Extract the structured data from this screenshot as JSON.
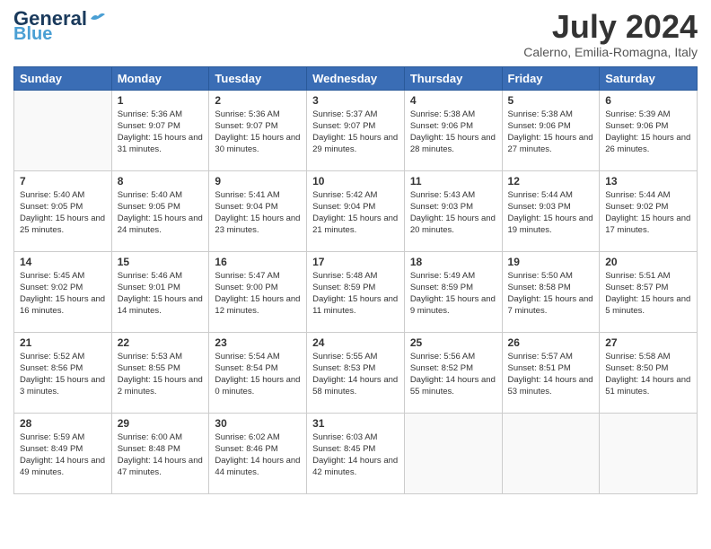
{
  "header": {
    "logo_line1": "General",
    "logo_line2": "Blue",
    "month": "July 2024",
    "location": "Calerno, Emilia-Romagna, Italy"
  },
  "weekdays": [
    "Sunday",
    "Monday",
    "Tuesday",
    "Wednesday",
    "Thursday",
    "Friday",
    "Saturday"
  ],
  "weeks": [
    [
      {
        "day": "",
        "sunrise": "",
        "sunset": "",
        "daylight": ""
      },
      {
        "day": "1",
        "sunrise": "Sunrise: 5:36 AM",
        "sunset": "Sunset: 9:07 PM",
        "daylight": "Daylight: 15 hours and 31 minutes."
      },
      {
        "day": "2",
        "sunrise": "Sunrise: 5:36 AM",
        "sunset": "Sunset: 9:07 PM",
        "daylight": "Daylight: 15 hours and 30 minutes."
      },
      {
        "day": "3",
        "sunrise": "Sunrise: 5:37 AM",
        "sunset": "Sunset: 9:07 PM",
        "daylight": "Daylight: 15 hours and 29 minutes."
      },
      {
        "day": "4",
        "sunrise": "Sunrise: 5:38 AM",
        "sunset": "Sunset: 9:06 PM",
        "daylight": "Daylight: 15 hours and 28 minutes."
      },
      {
        "day": "5",
        "sunrise": "Sunrise: 5:38 AM",
        "sunset": "Sunset: 9:06 PM",
        "daylight": "Daylight: 15 hours and 27 minutes."
      },
      {
        "day": "6",
        "sunrise": "Sunrise: 5:39 AM",
        "sunset": "Sunset: 9:06 PM",
        "daylight": "Daylight: 15 hours and 26 minutes."
      }
    ],
    [
      {
        "day": "7",
        "sunrise": "Sunrise: 5:40 AM",
        "sunset": "Sunset: 9:05 PM",
        "daylight": "Daylight: 15 hours and 25 minutes."
      },
      {
        "day": "8",
        "sunrise": "Sunrise: 5:40 AM",
        "sunset": "Sunset: 9:05 PM",
        "daylight": "Daylight: 15 hours and 24 minutes."
      },
      {
        "day": "9",
        "sunrise": "Sunrise: 5:41 AM",
        "sunset": "Sunset: 9:04 PM",
        "daylight": "Daylight: 15 hours and 23 minutes."
      },
      {
        "day": "10",
        "sunrise": "Sunrise: 5:42 AM",
        "sunset": "Sunset: 9:04 PM",
        "daylight": "Daylight: 15 hours and 21 minutes."
      },
      {
        "day": "11",
        "sunrise": "Sunrise: 5:43 AM",
        "sunset": "Sunset: 9:03 PM",
        "daylight": "Daylight: 15 hours and 20 minutes."
      },
      {
        "day": "12",
        "sunrise": "Sunrise: 5:44 AM",
        "sunset": "Sunset: 9:03 PM",
        "daylight": "Daylight: 15 hours and 19 minutes."
      },
      {
        "day": "13",
        "sunrise": "Sunrise: 5:44 AM",
        "sunset": "Sunset: 9:02 PM",
        "daylight": "Daylight: 15 hours and 17 minutes."
      }
    ],
    [
      {
        "day": "14",
        "sunrise": "Sunrise: 5:45 AM",
        "sunset": "Sunset: 9:02 PM",
        "daylight": "Daylight: 15 hours and 16 minutes."
      },
      {
        "day": "15",
        "sunrise": "Sunrise: 5:46 AM",
        "sunset": "Sunset: 9:01 PM",
        "daylight": "Daylight: 15 hours and 14 minutes."
      },
      {
        "day": "16",
        "sunrise": "Sunrise: 5:47 AM",
        "sunset": "Sunset: 9:00 PM",
        "daylight": "Daylight: 15 hours and 12 minutes."
      },
      {
        "day": "17",
        "sunrise": "Sunrise: 5:48 AM",
        "sunset": "Sunset: 8:59 PM",
        "daylight": "Daylight: 15 hours and 11 minutes."
      },
      {
        "day": "18",
        "sunrise": "Sunrise: 5:49 AM",
        "sunset": "Sunset: 8:59 PM",
        "daylight": "Daylight: 15 hours and 9 minutes."
      },
      {
        "day": "19",
        "sunrise": "Sunrise: 5:50 AM",
        "sunset": "Sunset: 8:58 PM",
        "daylight": "Daylight: 15 hours and 7 minutes."
      },
      {
        "day": "20",
        "sunrise": "Sunrise: 5:51 AM",
        "sunset": "Sunset: 8:57 PM",
        "daylight": "Daylight: 15 hours and 5 minutes."
      }
    ],
    [
      {
        "day": "21",
        "sunrise": "Sunrise: 5:52 AM",
        "sunset": "Sunset: 8:56 PM",
        "daylight": "Daylight: 15 hours and 3 minutes."
      },
      {
        "day": "22",
        "sunrise": "Sunrise: 5:53 AM",
        "sunset": "Sunset: 8:55 PM",
        "daylight": "Daylight: 15 hours and 2 minutes."
      },
      {
        "day": "23",
        "sunrise": "Sunrise: 5:54 AM",
        "sunset": "Sunset: 8:54 PM",
        "daylight": "Daylight: 15 hours and 0 minutes."
      },
      {
        "day": "24",
        "sunrise": "Sunrise: 5:55 AM",
        "sunset": "Sunset: 8:53 PM",
        "daylight": "Daylight: 14 hours and 58 minutes."
      },
      {
        "day": "25",
        "sunrise": "Sunrise: 5:56 AM",
        "sunset": "Sunset: 8:52 PM",
        "daylight": "Daylight: 14 hours and 55 minutes."
      },
      {
        "day": "26",
        "sunrise": "Sunrise: 5:57 AM",
        "sunset": "Sunset: 8:51 PM",
        "daylight": "Daylight: 14 hours and 53 minutes."
      },
      {
        "day": "27",
        "sunrise": "Sunrise: 5:58 AM",
        "sunset": "Sunset: 8:50 PM",
        "daylight": "Daylight: 14 hours and 51 minutes."
      }
    ],
    [
      {
        "day": "28",
        "sunrise": "Sunrise: 5:59 AM",
        "sunset": "Sunset: 8:49 PM",
        "daylight": "Daylight: 14 hours and 49 minutes."
      },
      {
        "day": "29",
        "sunrise": "Sunrise: 6:00 AM",
        "sunset": "Sunset: 8:48 PM",
        "daylight": "Daylight: 14 hours and 47 minutes."
      },
      {
        "day": "30",
        "sunrise": "Sunrise: 6:02 AM",
        "sunset": "Sunset: 8:46 PM",
        "daylight": "Daylight: 14 hours and 44 minutes."
      },
      {
        "day": "31",
        "sunrise": "Sunrise: 6:03 AM",
        "sunset": "Sunset: 8:45 PM",
        "daylight": "Daylight: 14 hours and 42 minutes."
      },
      {
        "day": "",
        "sunrise": "",
        "sunset": "",
        "daylight": ""
      },
      {
        "day": "",
        "sunrise": "",
        "sunset": "",
        "daylight": ""
      },
      {
        "day": "",
        "sunrise": "",
        "sunset": "",
        "daylight": ""
      }
    ]
  ]
}
